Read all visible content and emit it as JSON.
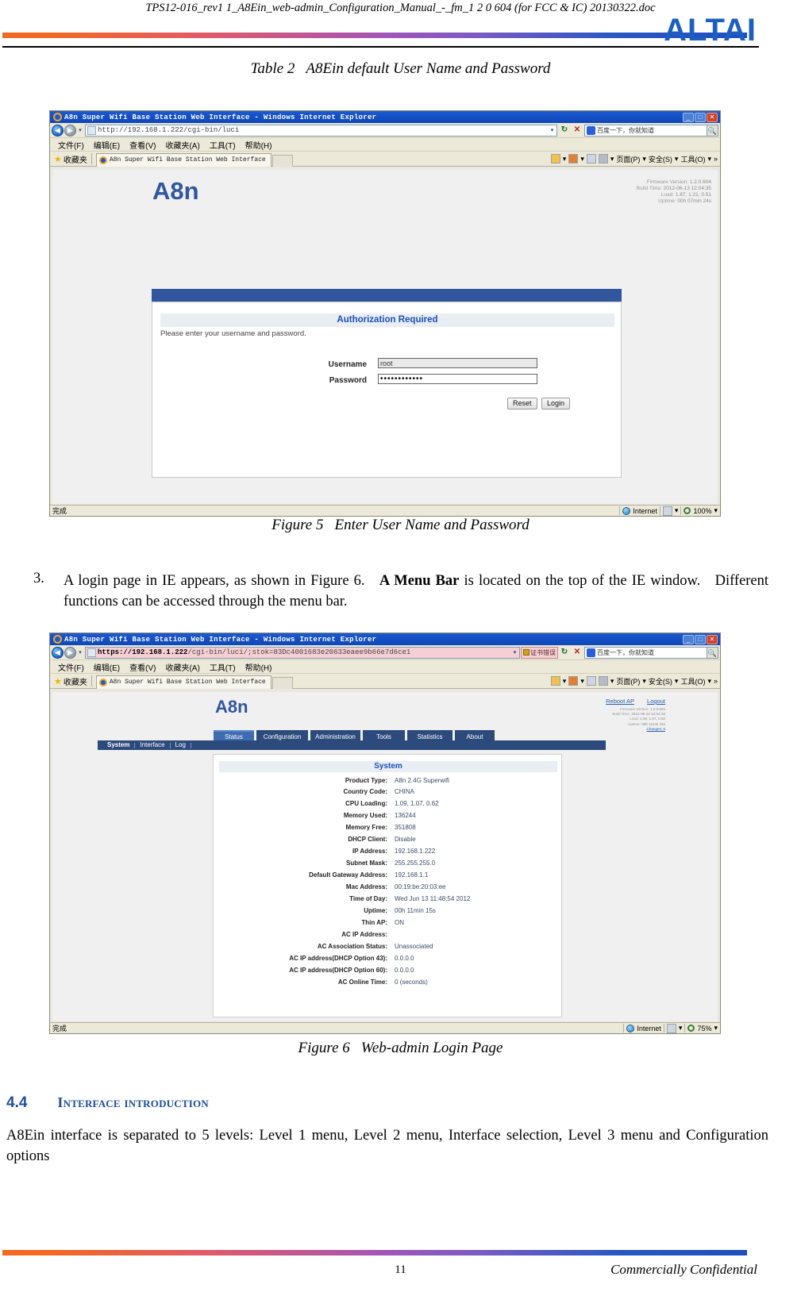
{
  "header": {
    "document_title": "TPS12-016_rev1 1_A8Ein_web-admin_Configuration_Manual_-_fm_1 2 0 604 (for FCC & IC) 20130322.doc",
    "logo_text": "ALTAI"
  },
  "table2_caption": {
    "label": "Table 2",
    "text": "A8Ein default User Name and Password"
  },
  "figure5": {
    "caption_label": "Figure 5",
    "caption_text": "Enter User Name and Password",
    "browser": {
      "window_title": "A8n Super Wifi Base Station Web Interface - Windows Internet Explorer",
      "url": "http://192.168.1.222/cgi-bin/luci",
      "url_prefix": "http://",
      "url_host": "192.168.1.222",
      "url_path": "/cgi-bin/luci",
      "menu_items": [
        "文件(F)",
        "编辑(E)",
        "查看(V)",
        "收藏夹(A)",
        "工具(T)",
        "帮助(H)"
      ],
      "favorites_label": "收藏夹",
      "tab_title": "A8n Super Wifi Base Station Web Interface",
      "search_placeholder": "百度一下，你就知道",
      "command_items": [
        "页面(P)",
        "安全(S)",
        "工具(O)"
      ],
      "overflow_label": "»",
      "status_text": "完成",
      "status_zone": "Internet",
      "status_zoom": "100%",
      "min_btn": "_",
      "max_btn": "□",
      "close_btn": "✕"
    },
    "page": {
      "brand": "A8n",
      "firmware": [
        {
          "label": "Firmware Version:",
          "value": "1.2.0.604"
        },
        {
          "label": "Build Time:",
          "value": "2012-06-13 12:04:35"
        },
        {
          "label": "Load:",
          "value": "1.87, 1.21, 0.51"
        },
        {
          "label": "Uptime:",
          "value": "00h 07min 24s"
        }
      ],
      "auth_title": "Authorization Required",
      "auth_subtitle": "Please enter your username and password.",
      "username_label": "Username",
      "username_value": "root",
      "password_label": "Password",
      "password_value": "••••••••••••",
      "reset_button": "Reset",
      "login_button": "Login"
    }
  },
  "step3": {
    "number": "3.",
    "text_part1": "A login page in IE appears, as shown in Figure 6.",
    "text_bold": "A Menu Bar",
    "text_part2": "is located on the top of the IE window.",
    "text_part3": "Different functions can be accessed through the menu bar."
  },
  "figure6": {
    "caption_label": "Figure 6",
    "caption_text": "Web-admin Login Page",
    "browser": {
      "window_title": "A8n Super Wifi Base Station Web Interface - Windows Internet Explorer",
      "url_prefix": "https://",
      "url_host": "192.168.1.222",
      "url_path": "/cgi-bin/luci/;stok=83Dc4001683e20633eaee9b66e7d6ce1",
      "cert_label": "证书错误",
      "menu_items": [
        "文件(F)",
        "编辑(E)",
        "查看(V)",
        "收藏夹(A)",
        "工具(T)",
        "帮助(H)"
      ],
      "favorites_label": "收藏夹",
      "tab_title": "A8n Super Wifi Base Station Web Interface",
      "search_placeholder": "百度一下，你就知道",
      "command_items": [
        "页面(P)",
        "安全(S)",
        "工具(O)"
      ],
      "overflow_label": "»",
      "status_text": "完成",
      "status_zone": "Internet",
      "status_zoom": "75%",
      "min_btn": "_",
      "max_btn": "□",
      "close_btn": "✕"
    },
    "page": {
      "brand": "A8n",
      "top_links": [
        "Reboot AP",
        "Logout"
      ],
      "firmware": [
        {
          "label": "Firmware version:",
          "value": "1.2.0.604"
        },
        {
          "label": "Build Time:",
          "value": "2012-06-13 12:04:35"
        },
        {
          "label": "Load:",
          "value": "1.09, 1.07, 0.62"
        },
        {
          "label": "Uptime:",
          "value": "00h 11min 15s"
        }
      ],
      "changes_link": "Changes: 0",
      "tabs": [
        "Status",
        "Configuration",
        "Administration",
        "Tools",
        "Statistics",
        "About"
      ],
      "active_tab": "Status",
      "subtabs": [
        "System",
        "Interface",
        "Log"
      ],
      "active_subtab": "System",
      "panel_title": "System",
      "rows": [
        {
          "key": "Product Type:",
          "value": "A8n 2.4G Superwifi"
        },
        {
          "key": "Country Code:",
          "value": "CHINA"
        },
        {
          "key": "CPU Loading:",
          "value": "1.09, 1.07, 0.62"
        },
        {
          "key": "Memory Used:",
          "value": "136244"
        },
        {
          "key": "Memory Free:",
          "value": "351808"
        },
        {
          "key": "DHCP Client:",
          "value": "Disable"
        },
        {
          "key": "IP Address:",
          "value": "192.168.1.222"
        },
        {
          "key": "Subnet Mask:",
          "value": "255.255.255.0"
        },
        {
          "key": "Default Gateway Address:",
          "value": "192.168.1.1"
        },
        {
          "key": "Mac Address:",
          "value": "00:19:be:20:03:ee"
        },
        {
          "key": "Time of Day:",
          "value": "Wed Jun 13 11:48:54 2012"
        },
        {
          "key": "Uptime:",
          "value": "00h 11min 15s"
        },
        {
          "key": "Thin AP:",
          "value": "ON"
        },
        {
          "key": "AC IP Address:",
          "value": ""
        },
        {
          "key": "AC Association Status:",
          "value": "Unassociated"
        },
        {
          "key": "AC IP address(DHCP Option 43):",
          "value": "0.0.0.0"
        },
        {
          "key": "AC IP address(DHCP Option 60):",
          "value": "0.0.0.0"
        },
        {
          "key": "AC Online Time:",
          "value": "0 (seconds)"
        }
      ]
    }
  },
  "section44": {
    "number": "4.4",
    "title": "Interface introduction",
    "body": "A8Ein interface is separated to 5 levels: Level 1 menu, Level 2 menu, Interface selection, Level 3 menu and Configuration options"
  },
  "footer": {
    "page_number": "11",
    "confidential": "Commercially Confidential"
  }
}
